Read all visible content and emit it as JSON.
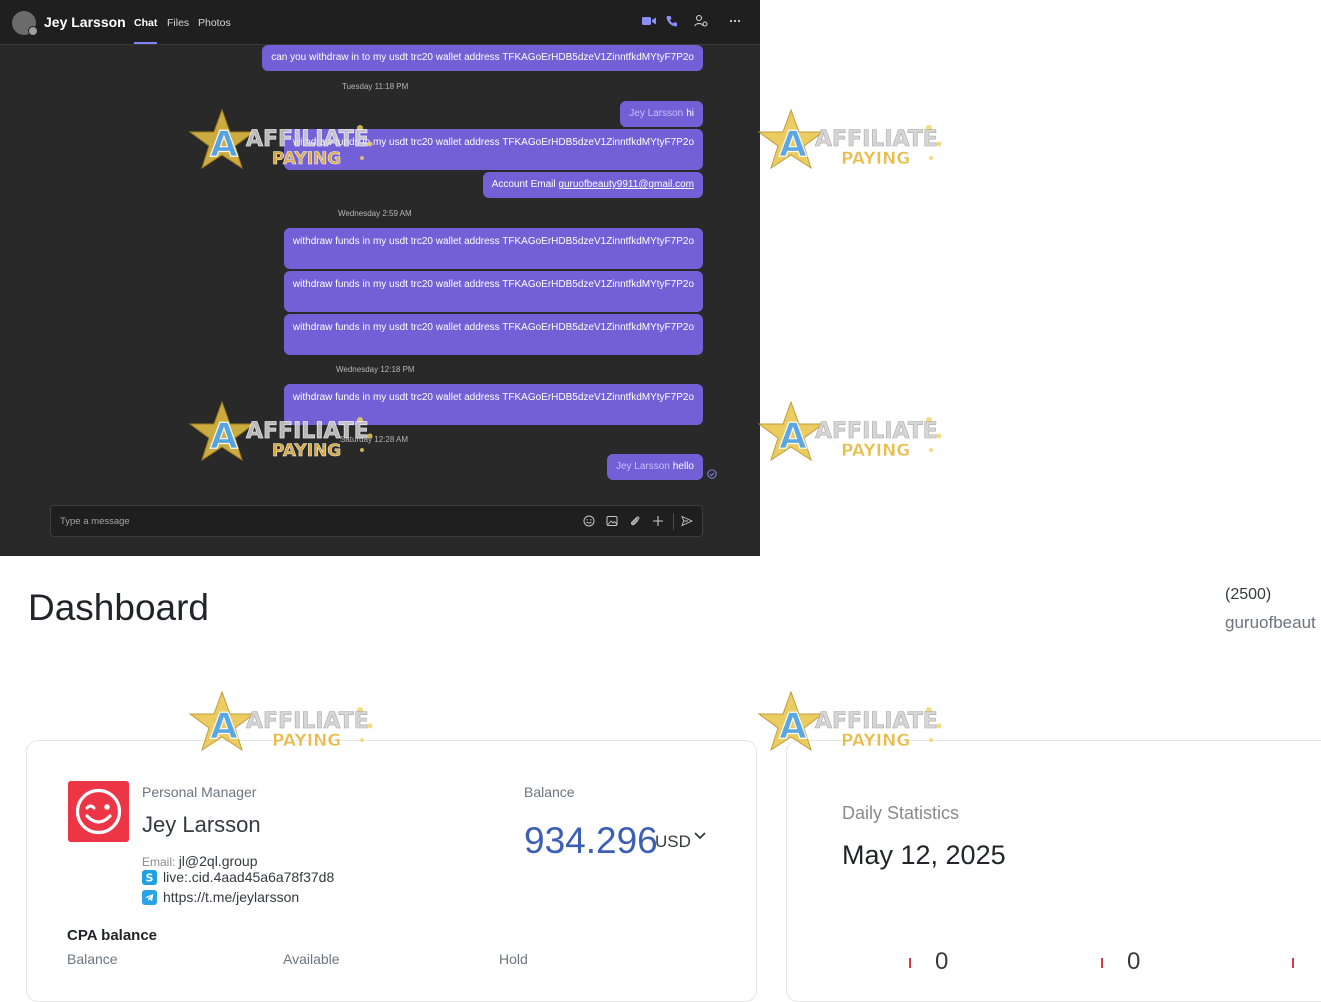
{
  "chat": {
    "contact_name": "Jey Larsson",
    "tabs": [
      "Chat",
      "Files",
      "Photos"
    ],
    "messages": [
      {
        "text": "can you withdraw in to my usdt trc20 wallet address   TFKAGoErHDB5dzeV1ZinntfkdMYtyF7P2o"
      },
      {
        "stamp": "Tuesday 11:18 PM"
      },
      {
        "sender": "Jey Larsson",
        "text": "hi"
      },
      {
        "text": "withdraw funds in my usdt trc20 wallet address   TFKAGoErHDB5dzeV1ZinntfkdMYtyF7P2o"
      },
      {
        "label": "Account Email",
        "email": "guruofbeauty9911@gmail.com"
      },
      {
        "stamp": "Wednesday 2:59 AM"
      },
      {
        "text": "withdraw funds in my usdt trc20 wallet address   TFKAGoErHDB5dzeV1ZinntfkdMYtyF7P2o"
      },
      {
        "text": "withdraw funds in my usdt trc20 wallet address   TFKAGoErHDB5dzeV1ZinntfkdMYtyF7P2o"
      },
      {
        "text": "withdraw funds in my usdt trc20 wallet address   TFKAGoErHDB5dzeV1ZinntfkdMYtyF7P2o"
      },
      {
        "stamp": "Wednesday 12:18 PM"
      },
      {
        "text": "withdraw funds in my usdt trc20 wallet address   TFKAGoErHDB5dzeV1ZinntfkdMYtyF7P2o"
      },
      {
        "stamp": "Saturday 12:28 AM"
      },
      {
        "sender": "Jey Larsson",
        "text": "hello"
      }
    ],
    "compose_placeholder": "Type a message",
    "accent_color": "#7360d6"
  },
  "watermark": {
    "line1": "AFFILIATE",
    "line2": "PAYING"
  },
  "dashboard": {
    "title": "Dashboard",
    "account_count": "(2500)",
    "account_email": "guruofbeaut",
    "manager": {
      "label": "Personal Manager",
      "name": "Jey Larsson",
      "email_label": "Email:",
      "email": "jl@2ql.group",
      "skype": "live:.cid.4aad45a6a78f37d8",
      "telegram": "https://t.me/jeylarsson"
    },
    "balance": {
      "label": "Balance",
      "value": "934.296",
      "currency": "USD"
    },
    "cpa": {
      "title": "CPA balance",
      "columns": [
        "Balance",
        "Available",
        "Hold"
      ]
    },
    "daily": {
      "label": "Daily Statistics",
      "date": "May 12, 2025",
      "values": [
        "0",
        "0"
      ]
    }
  }
}
